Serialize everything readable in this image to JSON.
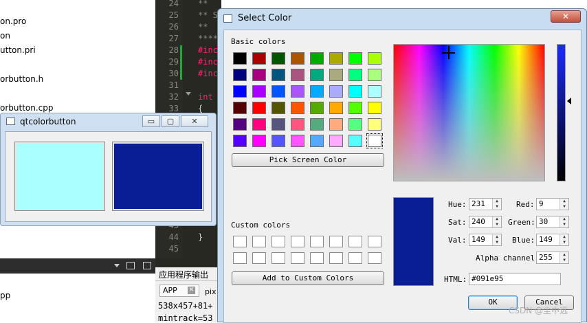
{
  "file_tree": [
    "on.pro",
    "on",
    "utton.pri",
    "orbutton.h",
    "orbutton.cpp",
    "pp"
  ],
  "editor": {
    "line_numbers": [
      "24",
      "25",
      "26",
      "27",
      "28",
      "29",
      "30",
      "31",
      "32",
      "33",
      "43",
      "44",
      "45"
    ],
    "code": [
      "**",
      "** S",
      "**",
      "****",
      "#inc",
      "#inc",
      "#inc",
      "int",
      "{",
      "}"
    ]
  },
  "output_panel": {
    "title": "应用程序输出",
    "tab_app": "APP",
    "tab_pix": "pix",
    "line1": "538x457+81+",
    "line2": "mintrack=53"
  },
  "qt_window": {
    "title": "qtcolorbutton",
    "button1_color": "#aaffff",
    "button2_color": "#091e95"
  },
  "dialog": {
    "title": "Select Color",
    "basic_colors_label": "Basic colors",
    "basic_colors": [
      "#000000",
      "#aa0000",
      "#005500",
      "#aa5500",
      "#00aa00",
      "#aaaa00",
      "#00ff00",
      "#aaff00",
      "#00007f",
      "#aa007f",
      "#00557f",
      "#aa557f",
      "#00aa7f",
      "#aaaa7f",
      "#00ff7f",
      "#aaff7f",
      "#0000ff",
      "#aa00ff",
      "#0055ff",
      "#aa55ff",
      "#00aaff",
      "#aaaaff",
      "#00ffff",
      "#aaffff",
      "#550000",
      "#ff0000",
      "#555500",
      "#ff5500",
      "#55aa00",
      "#ffaa00",
      "#55ff00",
      "#ffff00",
      "#55007f",
      "#ff007f",
      "#55557f",
      "#ff557f",
      "#55aa7f",
      "#ffaa7f",
      "#55ff7f",
      "#ffff7f",
      "#5500ff",
      "#ff00ff",
      "#5555ff",
      "#ff55ff",
      "#55aaff",
      "#ffaaff",
      "#55ffff",
      "#ffffff"
    ],
    "pick_screen_label": "Pick Screen Color",
    "custom_colors_label": "Custom colors",
    "add_custom_label": "Add to Custom Colors",
    "current_color": "#091e95",
    "hue_label": "Hue:",
    "hue": "231",
    "sat_label": "Sat:",
    "sat": "240",
    "val_label": "Val:",
    "val": "149",
    "red_label": "Red:",
    "red": "9",
    "green_label": "Green:",
    "green": "30",
    "blue_label": "Blue:",
    "blue": "149",
    "alpha_label": "Alpha channel:",
    "alpha": "255",
    "html_label": "HTML:",
    "html": "#091e95",
    "ok_label": "OK",
    "cancel_label": "Cancel"
  },
  "watermark": "CSDN @尘中远"
}
